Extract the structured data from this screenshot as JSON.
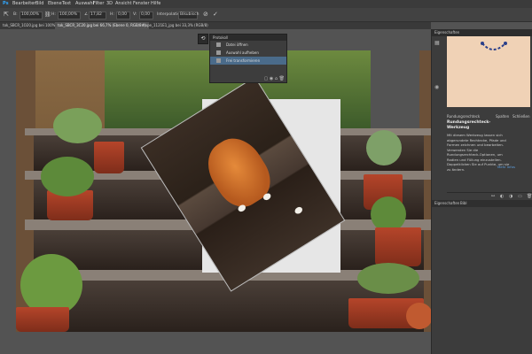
{
  "menubar": {
    "items": [
      "Ps",
      "Bearbeiten",
      "Bild",
      "Ebene",
      "Text",
      "Auswahl",
      "Filter",
      "3D",
      "Ansicht",
      "Fenster",
      "Hilfe"
    ]
  },
  "options": {
    "w_label": "B:",
    "w_value": "100,00%",
    "h_label": "H:",
    "h_value": "100,00%",
    "angle_value": "17,82",
    "skew_h_value": "0,00",
    "skew_v_value": "0,00",
    "interp_label": "Interpolation:",
    "interp_value": "Bikubisch",
    "cancel_icon": "cancel-icon",
    "commit_icon": "check-icon"
  },
  "tabs": [
    {
      "label": "tok_SBCR_1O20.jpg bei 100%...",
      "active": false
    },
    {
      "label": "tok_SBCR_3C20.jpg bei 66,7% (Ebene 0, RGB/8#)",
      "active": true
    },
    {
      "label": "nape_1121E1_jpg bei 33,3% (RGB/8)",
      "active": false
    }
  ],
  "properties_panel": {
    "title": "Protokoll",
    "rows": [
      {
        "label": "Datei öffnen",
        "icon": "document-icon",
        "selected": false
      },
      {
        "label": "Auswahl aufheben",
        "icon": "deselect-icon",
        "selected": false
      },
      {
        "label": "Frei transformieren",
        "icon": "transform-icon",
        "selected": true
      }
    ]
  },
  "right_panel": {
    "top_label": "Eigenschaften",
    "tabs": [
      "Rundungsrechteck",
      "Spalten",
      "Schließen"
    ],
    "title": "Rundungsrechteck-Werkzeug",
    "description": "Mit diesem Werkzeug lassen sich abgerundete Rechtecke, Pfade und Formen zeichnen und bearbeiten. Verwenden Sie die Rundungsrechteck-Optionen, um Radien und Füllung einzustellen. Doppelklicken Sie auf Punkte, um sie zu ändern.",
    "learn_more": "Mehr Infos",
    "bottom_tabs": [
      "Eigenschaften",
      "Bibl"
    ]
  }
}
